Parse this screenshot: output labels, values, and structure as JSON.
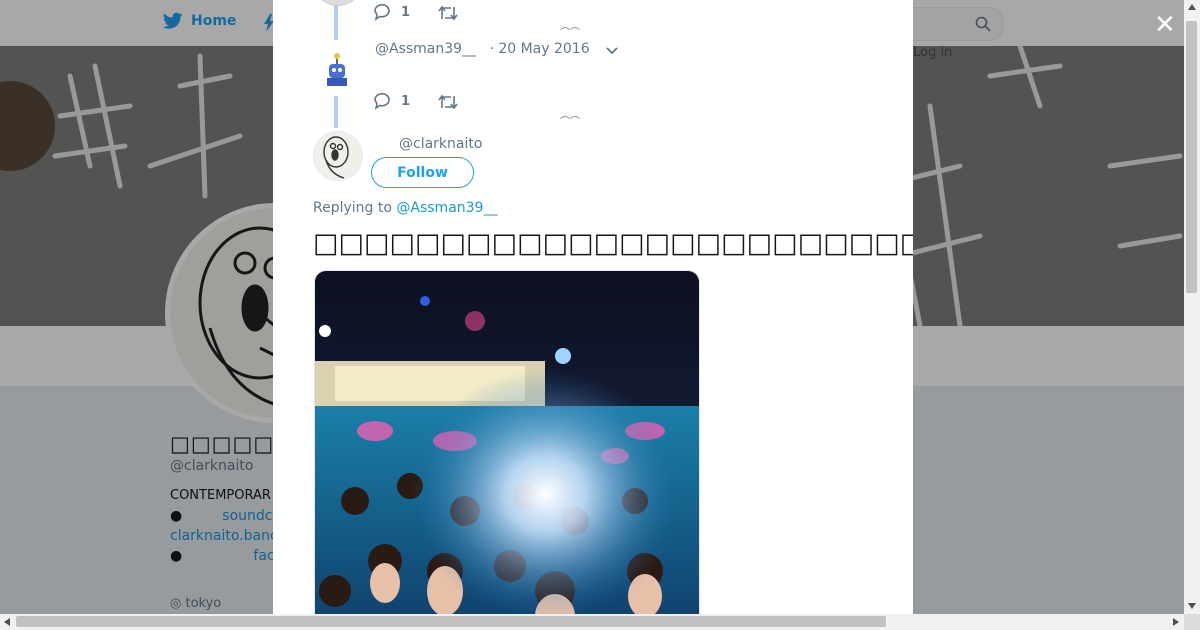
{
  "nav": {
    "home_label": "Home",
    "login_label": "Log in"
  },
  "profile": {
    "name": "□□□□□□",
    "handle": "@clarknaito",
    "bio": "CONTEMPORAR",
    "links": [
      {
        "bullet": "●",
        "text": "soundc"
      },
      {
        "bullet": "",
        "text": "clarknaito.banc"
      },
      {
        "bullet": "●",
        "text": "fac"
      }
    ],
    "location": "◎ tokyo"
  },
  "modal": {
    "top_tweet": {
      "reply_count": "1"
    },
    "reply_tweet": {
      "handle": "@Assman39__",
      "date": "· 20 May 2016",
      "reply_count": "1"
    },
    "main_tweet": {
      "handle": "@clarknaito",
      "follow_label": "Follow",
      "replying_prefix": "Replying to",
      "replying_to": "@Assman39__",
      "text": "□□□□□□□□□□□□□□□□□□□□□□□□□□□□□□□□□□□□□□□□□□□□□□□□□□□"
    }
  },
  "colors": {
    "accent": "#1da1f2",
    "thread_line": "#b9c9f3"
  },
  "icons": [
    "twitter-bird-icon",
    "search-icon",
    "close-icon",
    "reply-icon",
    "retweet-icon",
    "chevron-down-icon"
  ]
}
